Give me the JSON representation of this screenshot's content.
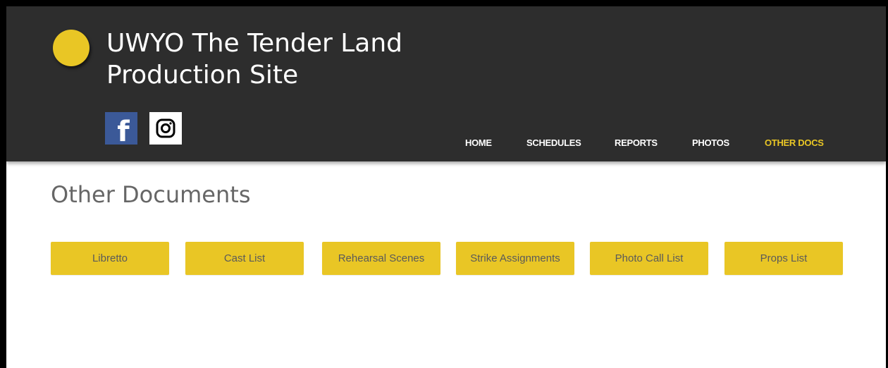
{
  "site": {
    "title": "UWYO The Tender Land Production Site",
    "brand_color": "#e9c625",
    "header_bg": "#2d2d2d"
  },
  "social": [
    {
      "icon": "facebook-icon",
      "label": "f"
    },
    {
      "icon": "instagram-icon"
    }
  ],
  "nav": {
    "items": [
      {
        "label": "HOME",
        "active": false
      },
      {
        "label": "SCHEDULES",
        "active": false
      },
      {
        "label": "REPORTS",
        "active": false
      },
      {
        "label": "PHOTOS",
        "active": false
      },
      {
        "label": "OTHER DOCS",
        "active": true
      }
    ]
  },
  "main": {
    "heading": "Other Documents",
    "documents": [
      {
        "label": "Libretto"
      },
      {
        "label": "Cast List"
      },
      {
        "label": "Rehearsal Scenes"
      },
      {
        "label": "Strike Assignments"
      },
      {
        "label": "Photo Call List"
      },
      {
        "label": "Props List"
      }
    ]
  }
}
